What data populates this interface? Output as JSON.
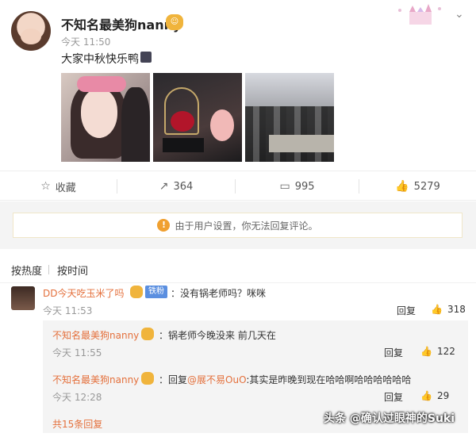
{
  "post": {
    "username": "不知名最美狗nanny",
    "time": "今天 11:50",
    "text": "大家中秋快乐鸭"
  },
  "actions": {
    "favorite": "收藏",
    "repost": "364",
    "comments": "995",
    "likes": "5279"
  },
  "notice": "由于用户设置，你无法回复评论。",
  "sort": {
    "hot": "按热度",
    "time": "按时间"
  },
  "comment": {
    "username": "DD今天吃玉米了吗",
    "fan_badge": "铁粉",
    "text": "：没有锅老师吗？咪咪",
    "time": "今天 11:53",
    "reply": "回复",
    "likes": "318"
  },
  "replies": [
    {
      "username": "不知名最美狗nanny",
      "text": "：锅老师今晚没来 前几天在",
      "time": "今天 11:55",
      "reply": "回复",
      "likes": "122"
    },
    {
      "username": "不知名最美狗nanny",
      "prefix": "：回复",
      "mention": "@展不易OuO",
      "text": ":其实是昨晚到现在哈哈啊哈哈哈哈哈哈",
      "time": "今天 12:28",
      "reply": "回复",
      "likes": "29"
    }
  ],
  "more_replies": "共15条回复",
  "watermark": "头条 @确认过眼神的Suki",
  "icons": {
    "star": "star-icon",
    "repost": "repost-icon",
    "comment": "comment-icon",
    "like": "thumbs-up-icon",
    "warning": "warning-icon",
    "chevron": "chevron-down-icon"
  },
  "colors": {
    "username_orange": "#e4703c",
    "fan_badge_blue": "#5b8fe0",
    "warning_orange": "#f0a030"
  }
}
